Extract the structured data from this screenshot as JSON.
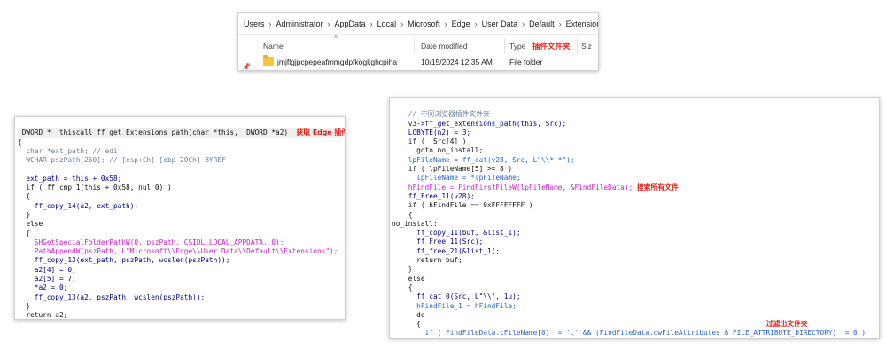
{
  "explorer": {
    "breadcrumbs": [
      "Users",
      "Administrator",
      "AppData",
      "Local",
      "Microsoft",
      "Edge",
      "User Data",
      "Default",
      "Extensions"
    ],
    "columns": {
      "name": "Name",
      "date": "Date modified",
      "type": "Type",
      "size": "Siz"
    },
    "annotation": "插件文件夹",
    "row": {
      "name": "jmjflgjpcpepeafmmgdpfkogkghcpiha",
      "date": "10/15/2024 12:35 AM",
      "type": "File folder"
    }
  },
  "left_code": {
    "annotation": "获取 Edge 插件文件夹路径",
    "lines": [
      "_DWORD *__thiscall ff_get_Extensions_path(char *this, _DWORD *a2)",
      "{",
      "  char *ext_path; // edi",
      "  WCHAR pszPath[260]; // [esp+Ch] [ebp-20Ch] BYREF",
      "",
      "  ext_path = this + 0x58;",
      "  if ( ff_cmp_1(this + 0x58, nul_0) )",
      "  {",
      "    ff_copy_14(a2, ext_path);",
      "  }",
      "  else",
      "  {",
      "    SHGetSpecialFolderPathW(0, pszPath, CSIDL_LOCAL_APPDATA, 0);",
      "    PathAppendW(pszPath, L\"Microsoft\\\\Edge\\\\User Data\\\\Default\\\\Extensions\");",
      "    ff_copy_13(ext_path, pszPath, wcslen(pszPath));",
      "    a2[4] = 0;",
      "    a2[5] = 7;",
      "    *a2 = 0;",
      "    ff_copy_13(a2, pszPath, wcslen(pszPath));",
      "  }",
      "  return a2;",
      "}"
    ]
  },
  "right_code": {
    "annotation_search": "搜索所有文件",
    "annotation_filter": "过滤出文件夹",
    "lines": [
      "    // 不同浏览器插件文件夹",
      "    v3->ff_get_extensions_path(this, Src);",
      "    LOBYTE(n2) = 3;",
      "    if ( !Src[4] )",
      "      goto no_install;",
      "    lpFileName = ff_cat(v28, Src, L\"\\\\*.*\");",
      "    if ( lpFileName[5] >= 8 )",
      "      lpFileName = *lpFileName;",
      "    hFindFile = FindFirstFileW(lpFileName, &FindFileData);",
      "    ff_Free_11(v28);",
      "    if ( hFindFile == 0xFFFFFFFF )",
      "    {",
      "no_install:",
      "      ff_copy_11(buf, &list_1);",
      "      ff_Free_11(Src);",
      "      ff_free_21(&list_1);",
      "      return buf;",
      "    }",
      "    else",
      "    {",
      "      ff_cat_0(Src, L\"\\\\\", 1u);",
      "      hFindFile_1 = hFindFile;",
      "      do",
      "      {",
      "        if ( FindFileData.cFileName[0] != '.' && (FindFileData.dwFileAttributes & FILE_ATTRIBUTE_DIRECTORY) != 0 )",
      "        {"
    ]
  },
  "colors": {
    "annotation": "#e0201d",
    "call_blue": "#2a62c9",
    "call_pink": "#c81ec8",
    "comment": "#6b7fa0"
  }
}
